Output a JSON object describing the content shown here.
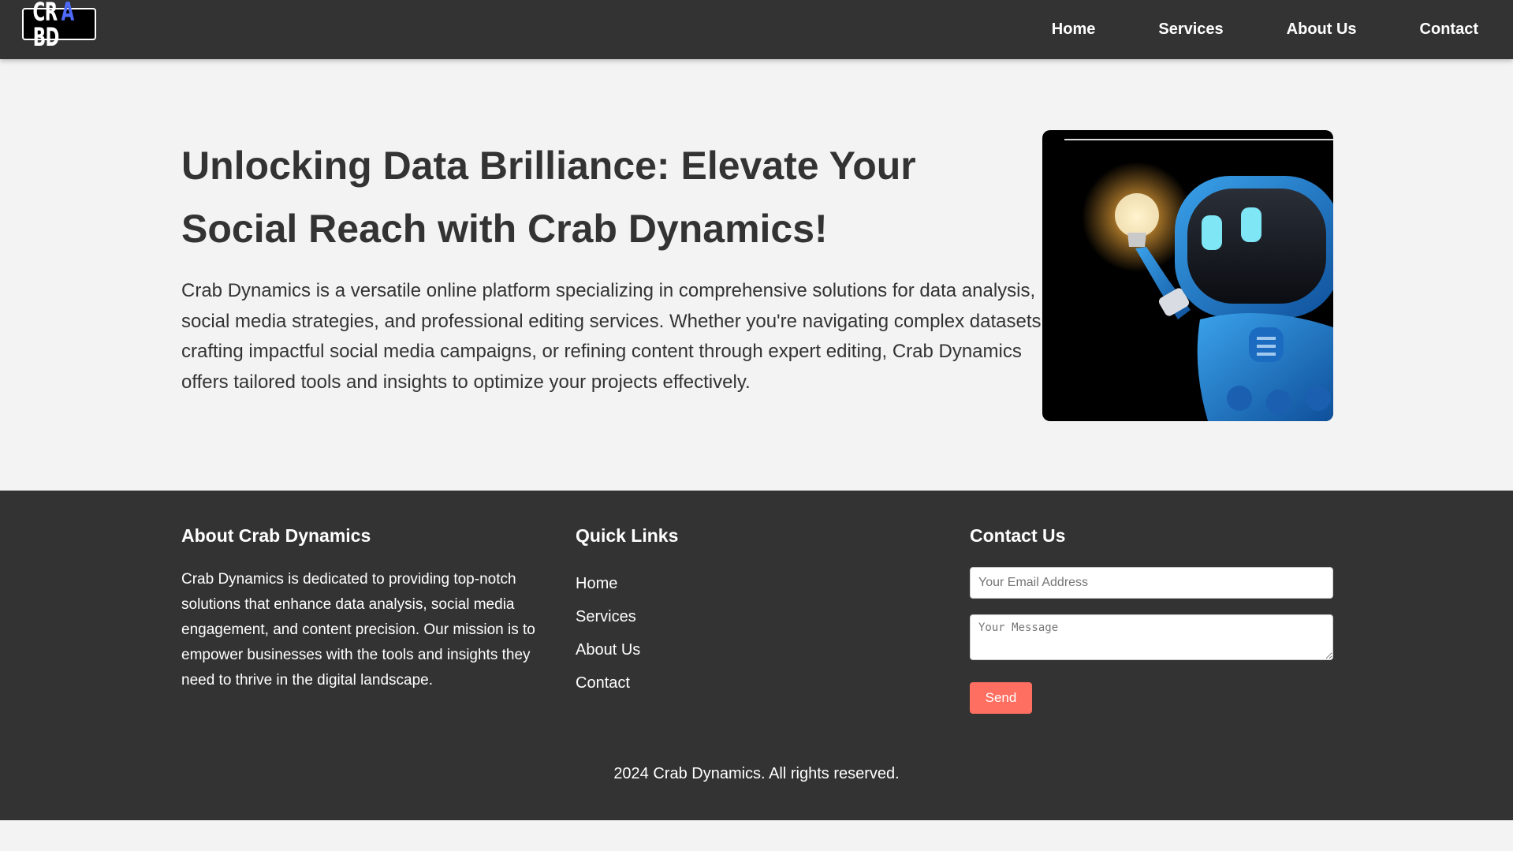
{
  "header": {
    "logo": {
      "part1": "CR",
      "part2": "A",
      "part3": "BD"
    },
    "nav": [
      {
        "label": "Home"
      },
      {
        "label": "Services"
      },
      {
        "label": "About Us"
      },
      {
        "label": "Contact"
      }
    ]
  },
  "hero": {
    "title": "Unlocking Data Brilliance: Elevate Your Social Reach with Crab Dynamics!",
    "description": "Crab Dynamics is a versatile online platform specializing in comprehensive solutions for data analysis, social media strategies, and professional editing services. Whether you're navigating complex datasets, crafting impactful social media campaigns, or refining content through expert editing, Crab Dynamics offers tailored tools and insights to optimize your projects effectively.",
    "image_icon": "robot-holding-lightbulb"
  },
  "footer": {
    "about": {
      "heading": "About Crab Dynamics",
      "text": "Crab Dynamics is dedicated to providing top-notch solutions that enhance data analysis, social media engagement, and content precision. Our mission is to empower businesses with the tools and insights they need to thrive in the digital landscape."
    },
    "links": {
      "heading": "Quick Links",
      "items": [
        {
          "label": "Home"
        },
        {
          "label": "Services"
        },
        {
          "label": "About Us"
        },
        {
          "label": "Contact"
        }
      ]
    },
    "contact": {
      "heading": "Contact Us",
      "email_placeholder": "Your Email Address",
      "message_placeholder": "Your Message",
      "send_label": "Send"
    },
    "copyright": "2024 Crab Dynamics. All rights reserved."
  },
  "colors": {
    "header_bg": "#333333",
    "page_bg": "#f3f3f3",
    "footer_bg": "#333333",
    "send_button": "#ff6f61",
    "logo_accent": "#4f6bff"
  }
}
